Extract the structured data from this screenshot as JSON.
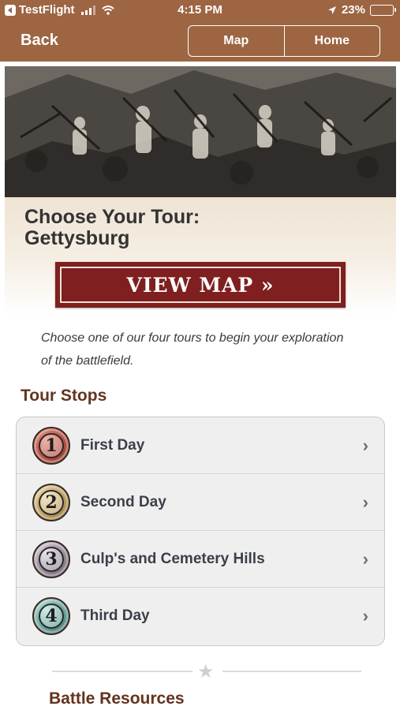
{
  "status_bar": {
    "carrier": "TestFlight",
    "time": "4:15 PM",
    "battery": "23%"
  },
  "nav": {
    "back_label": "Back",
    "segments": [
      "Map",
      "Home"
    ]
  },
  "page": {
    "title_line1": "Choose Your Tour:",
    "title_line2": "Gettysburg",
    "view_map_label": "VIEW MAP »",
    "intro_line1": "Choose one of our four tours to begin your exploration",
    "intro_line2": "of the battlefield."
  },
  "tour_stops": {
    "heading": "Tour Stops",
    "items": [
      {
        "number": "1",
        "label": "First Day",
        "badge_color": "#b24a3c"
      },
      {
        "number": "2",
        "label": "Second Day",
        "badge_color": "#b8995a"
      },
      {
        "number": "3",
        "label": "Culp's and Cemetery Hills",
        "badge_color": "#8f8190"
      },
      {
        "number": "4",
        "label": "Third Day",
        "badge_color": "#5f9a93"
      }
    ]
  },
  "battle_resources": {
    "heading": "Battle Resources"
  },
  "colors": {
    "brand_brown": "#9d6542",
    "view_map_red": "#7f1f1f",
    "heading_brown": "#63331f"
  }
}
